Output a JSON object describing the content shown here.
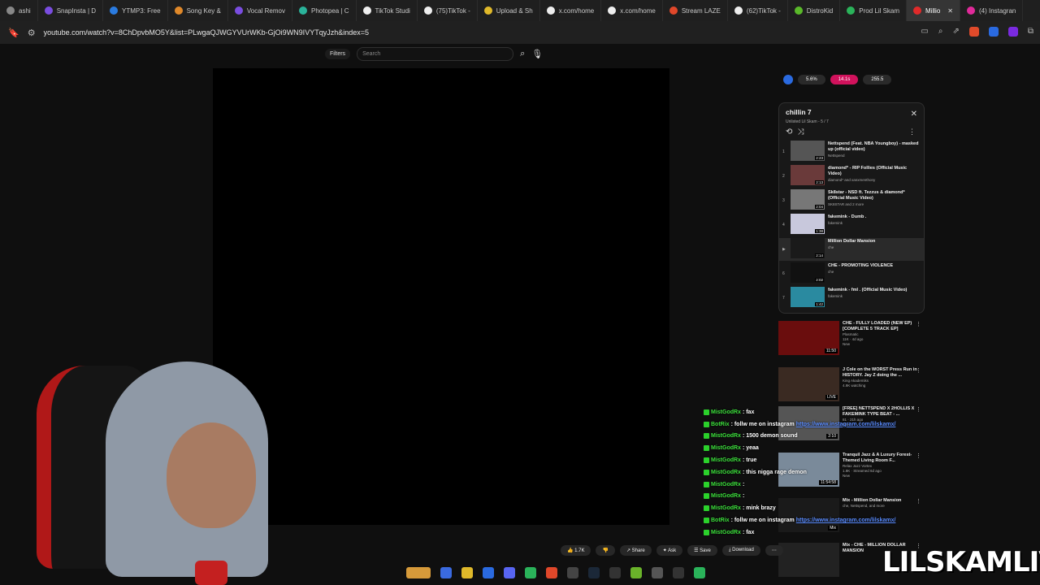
{
  "tabs": [
    {
      "label": "ashi",
      "color": "#888"
    },
    {
      "label": "SnapInsta | D",
      "color": "#7a4de0"
    },
    {
      "label": "YTMP3: Free",
      "color": "#2a7be0"
    },
    {
      "label": "Song Key &",
      "color": "#e0892a"
    },
    {
      "label": "Vocal Remov",
      "color": "#7a4de0"
    },
    {
      "label": "Photopea | C",
      "color": "#2ab39a"
    },
    {
      "label": "TikTok Studi",
      "color": "#eeeeee"
    },
    {
      "label": "(75)TikTok -",
      "color": "#eeeeee"
    },
    {
      "label": "Upload & Sh",
      "color": "#e0b92a"
    },
    {
      "label": "x.com/home",
      "color": "#eeeeee"
    },
    {
      "label": "x.com/home",
      "color": "#eeeeee"
    },
    {
      "label": "Stream LAZE",
      "color": "#e0472a"
    },
    {
      "label": "(62)TikTok -",
      "color": "#eeeeee"
    },
    {
      "label": "DistroKid",
      "color": "#5ab92a"
    },
    {
      "label": "Prod Lil Skam",
      "color": "#2ab35a"
    },
    {
      "label": "Millio",
      "color": "#e02a2a",
      "active": true
    },
    {
      "label": "(4) Instagran",
      "color": "#e02a9a"
    }
  ],
  "address": {
    "url": "youtube.com/watch?v=8ChDpvbMO5Y&list=PLwgaQJWGYVUrWKb-GjOi9WN9IVYTqyJzh&index=5"
  },
  "search": {
    "filters_label": "Filters",
    "placeholder": "Search"
  },
  "stats": {
    "a": "5.6%",
    "b": "14.1s",
    "c": "255.5"
  },
  "playlist": {
    "title": "chillin 7",
    "subtitle": "Unlisted  Lil Skam - 5 / 7",
    "items": [
      {
        "num": "1",
        "title": "Nettspend (Feat. NBA Youngboy) - masked up (official video)",
        "channel": "Nettspend",
        "dur": "2:23",
        "thumb": "#555"
      },
      {
        "num": "2",
        "title": "diamond* - RIP Follies (Official Music Video)",
        "channel": "diamond* and xanxmenthony",
        "dur": "2:13",
        "thumb": "#6a3a3a"
      },
      {
        "num": "3",
        "title": "Sk8star - NSD ft. Tezzus & diamond* (Official Music Video)",
        "channel": "SK8STAR and 2 more",
        "dur": "2:04",
        "thumb": "#777"
      },
      {
        "num": "4",
        "title": "fakemink - Dumb .",
        "channel": "fakemink",
        "dur": "1:38",
        "thumb": "#c8c8dc"
      },
      {
        "num": "▶",
        "title": "Million Dollar Mansion",
        "channel": "che",
        "dur": "2:14",
        "thumb": "#1a1a1a",
        "active": true
      },
      {
        "num": "6",
        "title": "CHE - PROMOTING VIOLENCE",
        "channel": "che",
        "dur": "2:02",
        "thumb": "#111"
      },
      {
        "num": "7",
        "title": "fakemink - fml . (Official Music Video)",
        "channel": "fakemink",
        "dur": "1:42",
        "thumb": "#2a8aa0"
      }
    ]
  },
  "recs": [
    {
      "title": "CHE - FULLY LOADED (NEW EP) [COMPLETE 5 TRACK EP]",
      "meta1": "Plasmatic",
      "meta2": "11K · 4d ago",
      "meta3": "New",
      "dur": "11:50",
      "thumb": "#6a0d0d"
    },
    {
      "title": "J Cole on the WORST Press Run in HISTORY. Jay Z doing the ...",
      "meta1": "King Akademiks",
      "meta2": "4.9K watching",
      "meta3": "",
      "dur": "LIVE",
      "thumb": "#3a2a22"
    },
    {
      "title": "[FREE] NETTSPEND X 2HOLLIS X FAKEMINK TYPE BEAT - ...",
      "meta1": "",
      "meta2": "81 · 21h ago",
      "meta3": "New",
      "dur": "2:10",
      "thumb": "#555"
    },
    {
      "title": "Tranquil Jazz & A Luxury Forest-Themed Living Room F...",
      "meta1": "Relax Jazz Vortex",
      "meta2": "1.9K · Streamed 6d ago",
      "meta3": "New",
      "dur": "11:54:58",
      "thumb": "#7a8a9a"
    },
    {
      "title": "Mix - Million Dollar Mansion",
      "meta1": "che, Nettspend, and more",
      "meta2": "",
      "meta3": "",
      "dur": "Mix",
      "thumb": "#1a1a1a"
    },
    {
      "title": "Mix - CHE - MILLION DOLLAR MANSION",
      "meta1": "",
      "meta2": "",
      "meta3": "",
      "dur": "",
      "thumb": "#222"
    }
  ],
  "chat": [
    {
      "user": "MistGodRx",
      "msg": ": fax",
      "link": ""
    },
    {
      "user": "BotRix",
      "msg": ": follw me on instagram",
      "link": "https://www.instagram.com/lilskamx/"
    },
    {
      "user": "MistGodRx",
      "msg": ": 1500 demon sound",
      "link": ""
    },
    {
      "user": "MistGodRx",
      "msg": ": yeaa",
      "link": ""
    },
    {
      "user": "MistGodRx",
      "msg": ": true",
      "link": ""
    },
    {
      "user": "MistGodRx",
      "msg": ": this nigga rage demon",
      "link": ""
    },
    {
      "user": "MistGodRx",
      "msg": ":",
      "link": ""
    },
    {
      "user": "MistGodRx",
      "msg": ":",
      "link": ""
    },
    {
      "user": "MistGodRx",
      "msg": ": mink brazy",
      "link": ""
    },
    {
      "user": "BotRix",
      "msg": ": follw me on instagram",
      "link": "https://www.instagram.com/lilskamx/"
    },
    {
      "user": "MistGodRx",
      "msg": ": fax",
      "link": ""
    }
  ],
  "actions": {
    "likes": "1.7K",
    "share": "Share",
    "ask": "Ask",
    "save": "Save",
    "download": "Download"
  },
  "watermark": "LILSKAMLIVE"
}
